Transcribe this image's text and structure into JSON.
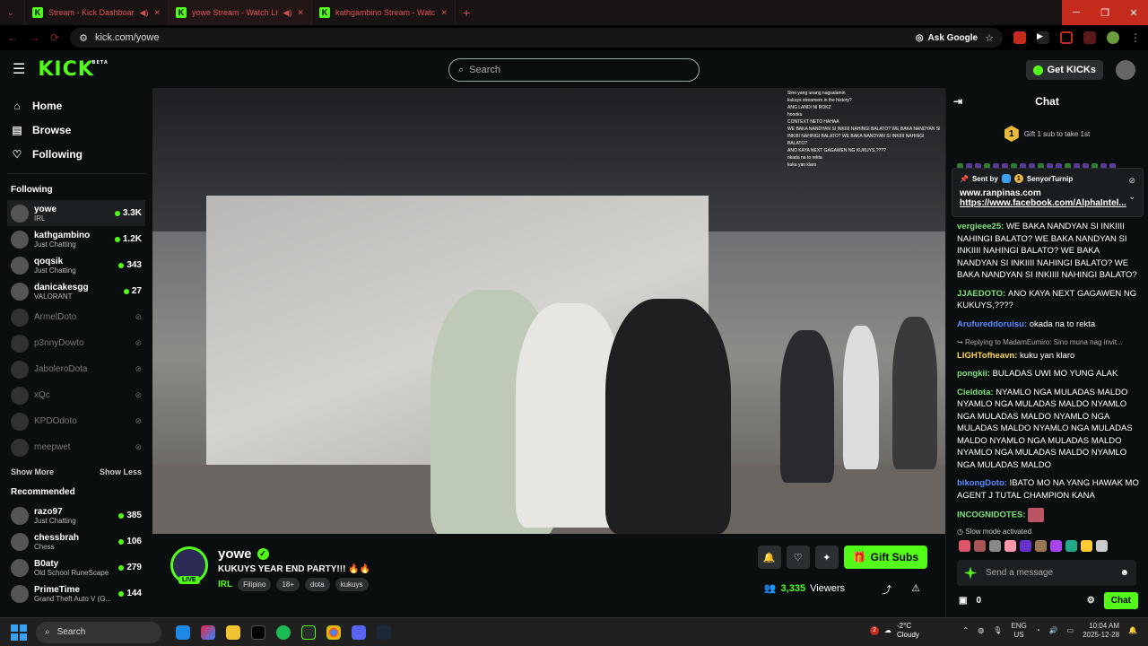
{
  "browser": {
    "tabs": [
      {
        "title": "Stream - Kick Dashboard"
      },
      {
        "title": "yowe Stream - Watch Live..."
      },
      {
        "title": "kathgambino Stream - Watch"
      }
    ],
    "url": "kick.com/yowe",
    "ask_google": "Ask Google"
  },
  "header": {
    "logo": "KICK",
    "beta": "BETA",
    "search_placeholder": "Search",
    "get_kicks": "Get KICKs"
  },
  "sidebar": {
    "nav": [
      {
        "label": "Home",
        "icon": "home-icon"
      },
      {
        "label": "Browse",
        "icon": "browse-icon"
      },
      {
        "label": "Following",
        "icon": "heart-icon"
      }
    ],
    "following_title": "Following",
    "following": [
      {
        "name": "yowe",
        "category": "IRL",
        "viewers": "3.3K",
        "live": true
      },
      {
        "name": "kathgambino",
        "category": "Just Chatting",
        "viewers": "1.2K",
        "live": true
      },
      {
        "name": "qoqsik",
        "category": "Just Chatting",
        "viewers": "343",
        "live": true
      },
      {
        "name": "danicakesgg",
        "category": "VALORANT",
        "viewers": "27",
        "live": true
      },
      {
        "name": "ArmelDoto",
        "live": false
      },
      {
        "name": "p3nnyDowto",
        "live": false
      },
      {
        "name": "JaboleroDota",
        "live": false
      },
      {
        "name": "xQc",
        "live": false
      },
      {
        "name": "KPDOdoto",
        "live": false
      },
      {
        "name": "meepwet",
        "live": false
      }
    ],
    "show_more": "Show More",
    "show_less": "Show Less",
    "recommended_title": "Recommended",
    "recommended": [
      {
        "name": "razo97",
        "category": "Just Chatting",
        "viewers": "385"
      },
      {
        "name": "chessbrah",
        "category": "Chess",
        "viewers": "106"
      },
      {
        "name": "B0aty",
        "category": "Old School RuneScape",
        "viewers": "279"
      },
      {
        "name": "PrimeTime",
        "category": "Grand Theft Auto V (G...",
        "viewers": "144"
      }
    ]
  },
  "video": {
    "overlay_chat": [
      "Sino yang unang nagsalamin",
      "kukuys streamers in the history?",
      "ANG LANDI NI ROKZ",
      "hoooku",
      "",
      "CONTEXT NETO HAHAA",
      "WE BAKA NANDYAN SI INKIIII NAHINGI BALATO? WE BAKA NANDYAN SI",
      "INKIIII NAHINGI BALATO? WE BAKA NANDYAN SI INKIIII NAHINGI",
      "BALATO?",
      "ANO KAYA NEXT GAGAWEN NG KUKUYS,????",
      "okada na to rekta",
      "kuku yan klaro"
    ]
  },
  "stream": {
    "name": "yowe",
    "live_label": "LIVE",
    "title": "KUKUYS YEAR END PARTY!!! 🔥🔥",
    "category": "IRL",
    "tags": [
      "Filipino",
      "18+",
      "dota",
      "kukuys"
    ],
    "gift_subs": "Gift Subs",
    "viewers": "3,335",
    "viewers_label": "Viewers"
  },
  "chat": {
    "title": "Chat",
    "gift_prompt": "Gift 1 sub to take 1st",
    "gift_rank": "1",
    "pinned": {
      "sent_by": "Sent by",
      "sender": "SenyorTurnip",
      "badge": "1",
      "line1": "www.ranpinas.com",
      "line2": "https://www.facebook.com/AlphaIntel..."
    },
    "messages": [
      {
        "user": "vergieee25",
        "color": "#7ee07a",
        "text": "WE BAKA NANDYAN SI INKIIII NAHINGI BALATO? WE BAKA NANDYAN SI INKIIII NAHINGI BALATO? WE BAKA NANDYAN SI INKIIII NAHINGI BALATO? WE BAKA NANDYAN SI INKIIII NAHINGI BALATO?"
      },
      {
        "user": "JJAEDOTO",
        "color": "#7ee07a",
        "text": "ANO KAYA NEXT GAGAWEN NG KUKUYS,????"
      },
      {
        "user": "Arufureddoruisu",
        "color": "#5b8cff",
        "text": "okada na to rekta"
      },
      {
        "user": "LIGHTofheavn",
        "color": "#ffd84d",
        "text": "kuku yan klaro",
        "reply": "Replying to MadamEumiro: Sino muna nag invit..."
      },
      {
        "user": "pongkii",
        "color": "#7ee07a",
        "text": "BULADAS UWI MO YUNG ALAK"
      },
      {
        "user": "Cieldota",
        "color": "#7ee07a",
        "text": "NYAMLO NGA MULADAS MALDO NYAMLO NGA MULADAS MALDO NYAMLO NGA MULADAS MALDO NYAMLO NGA MULADAS MALDO NYAMLO NGA MULADAS MALDO NYAMLO NGA MULADAS MALDO NYAMLO NGA MULADAS MALDO NYAMLO NGA MULADAS MALDO"
      },
      {
        "user": "bikongDoto",
        "color": "#5b8cff",
        "text": "IBATO MO NA YANG HAWAK MO AGENT J TUTAL CHAMPION KANA"
      },
      {
        "user": "INCOGNIDOTES",
        "color": "#7ee07a",
        "text": ""
      }
    ],
    "slow_mode": "Slow mode activated",
    "input_placeholder": "Send a message",
    "count": "0",
    "send": "Chat"
  },
  "taskbar": {
    "search": "Search",
    "weather_temp": "-2°C",
    "weather_desc": "Cloudy",
    "weather_badge": "2",
    "lang1": "ENG",
    "lang2": "US",
    "time": "10:04 AM",
    "date": "2025-12-28"
  }
}
